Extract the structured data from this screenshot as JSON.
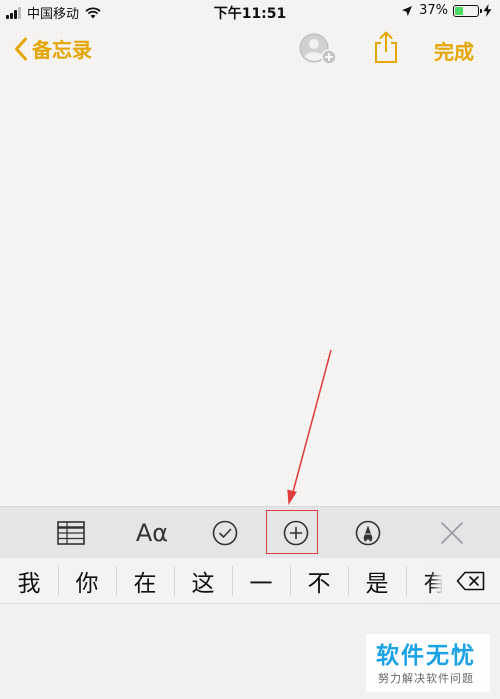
{
  "status_bar": {
    "carrier": "中国移动",
    "time": "下午11:51",
    "battery_percent": "37%",
    "battery_level": 0.37,
    "signal_icon": "signal-bars-icon",
    "wifi_icon": "wifi-icon",
    "location_icon": "location-arrow-icon",
    "charging_icon": "charging-bolt-icon"
  },
  "nav": {
    "back_label": "备忘录",
    "done_label": "完成",
    "collaborate_icon": "add-people-icon",
    "share_icon": "share-icon"
  },
  "toolbar": {
    "table_icon": "table-icon",
    "format_label": "Aα",
    "checklist_icon": "checkmark-circle-icon",
    "add_icon": "plus-circle-icon",
    "markup_icon": "pen-circle-icon",
    "close_icon": "close-icon"
  },
  "candidates": {
    "items": [
      "我",
      "你",
      "在",
      "这",
      "一",
      "不",
      "是",
      "有"
    ],
    "delete_icon": "backspace-icon"
  },
  "watermark": {
    "title": "软件无忧",
    "subtitle": "努力解决软件问题"
  },
  "colors": {
    "accent": "#e6a600",
    "annotation": "#e23b3b",
    "battery": "#4cd964",
    "watermark": "#1aa2e6"
  }
}
